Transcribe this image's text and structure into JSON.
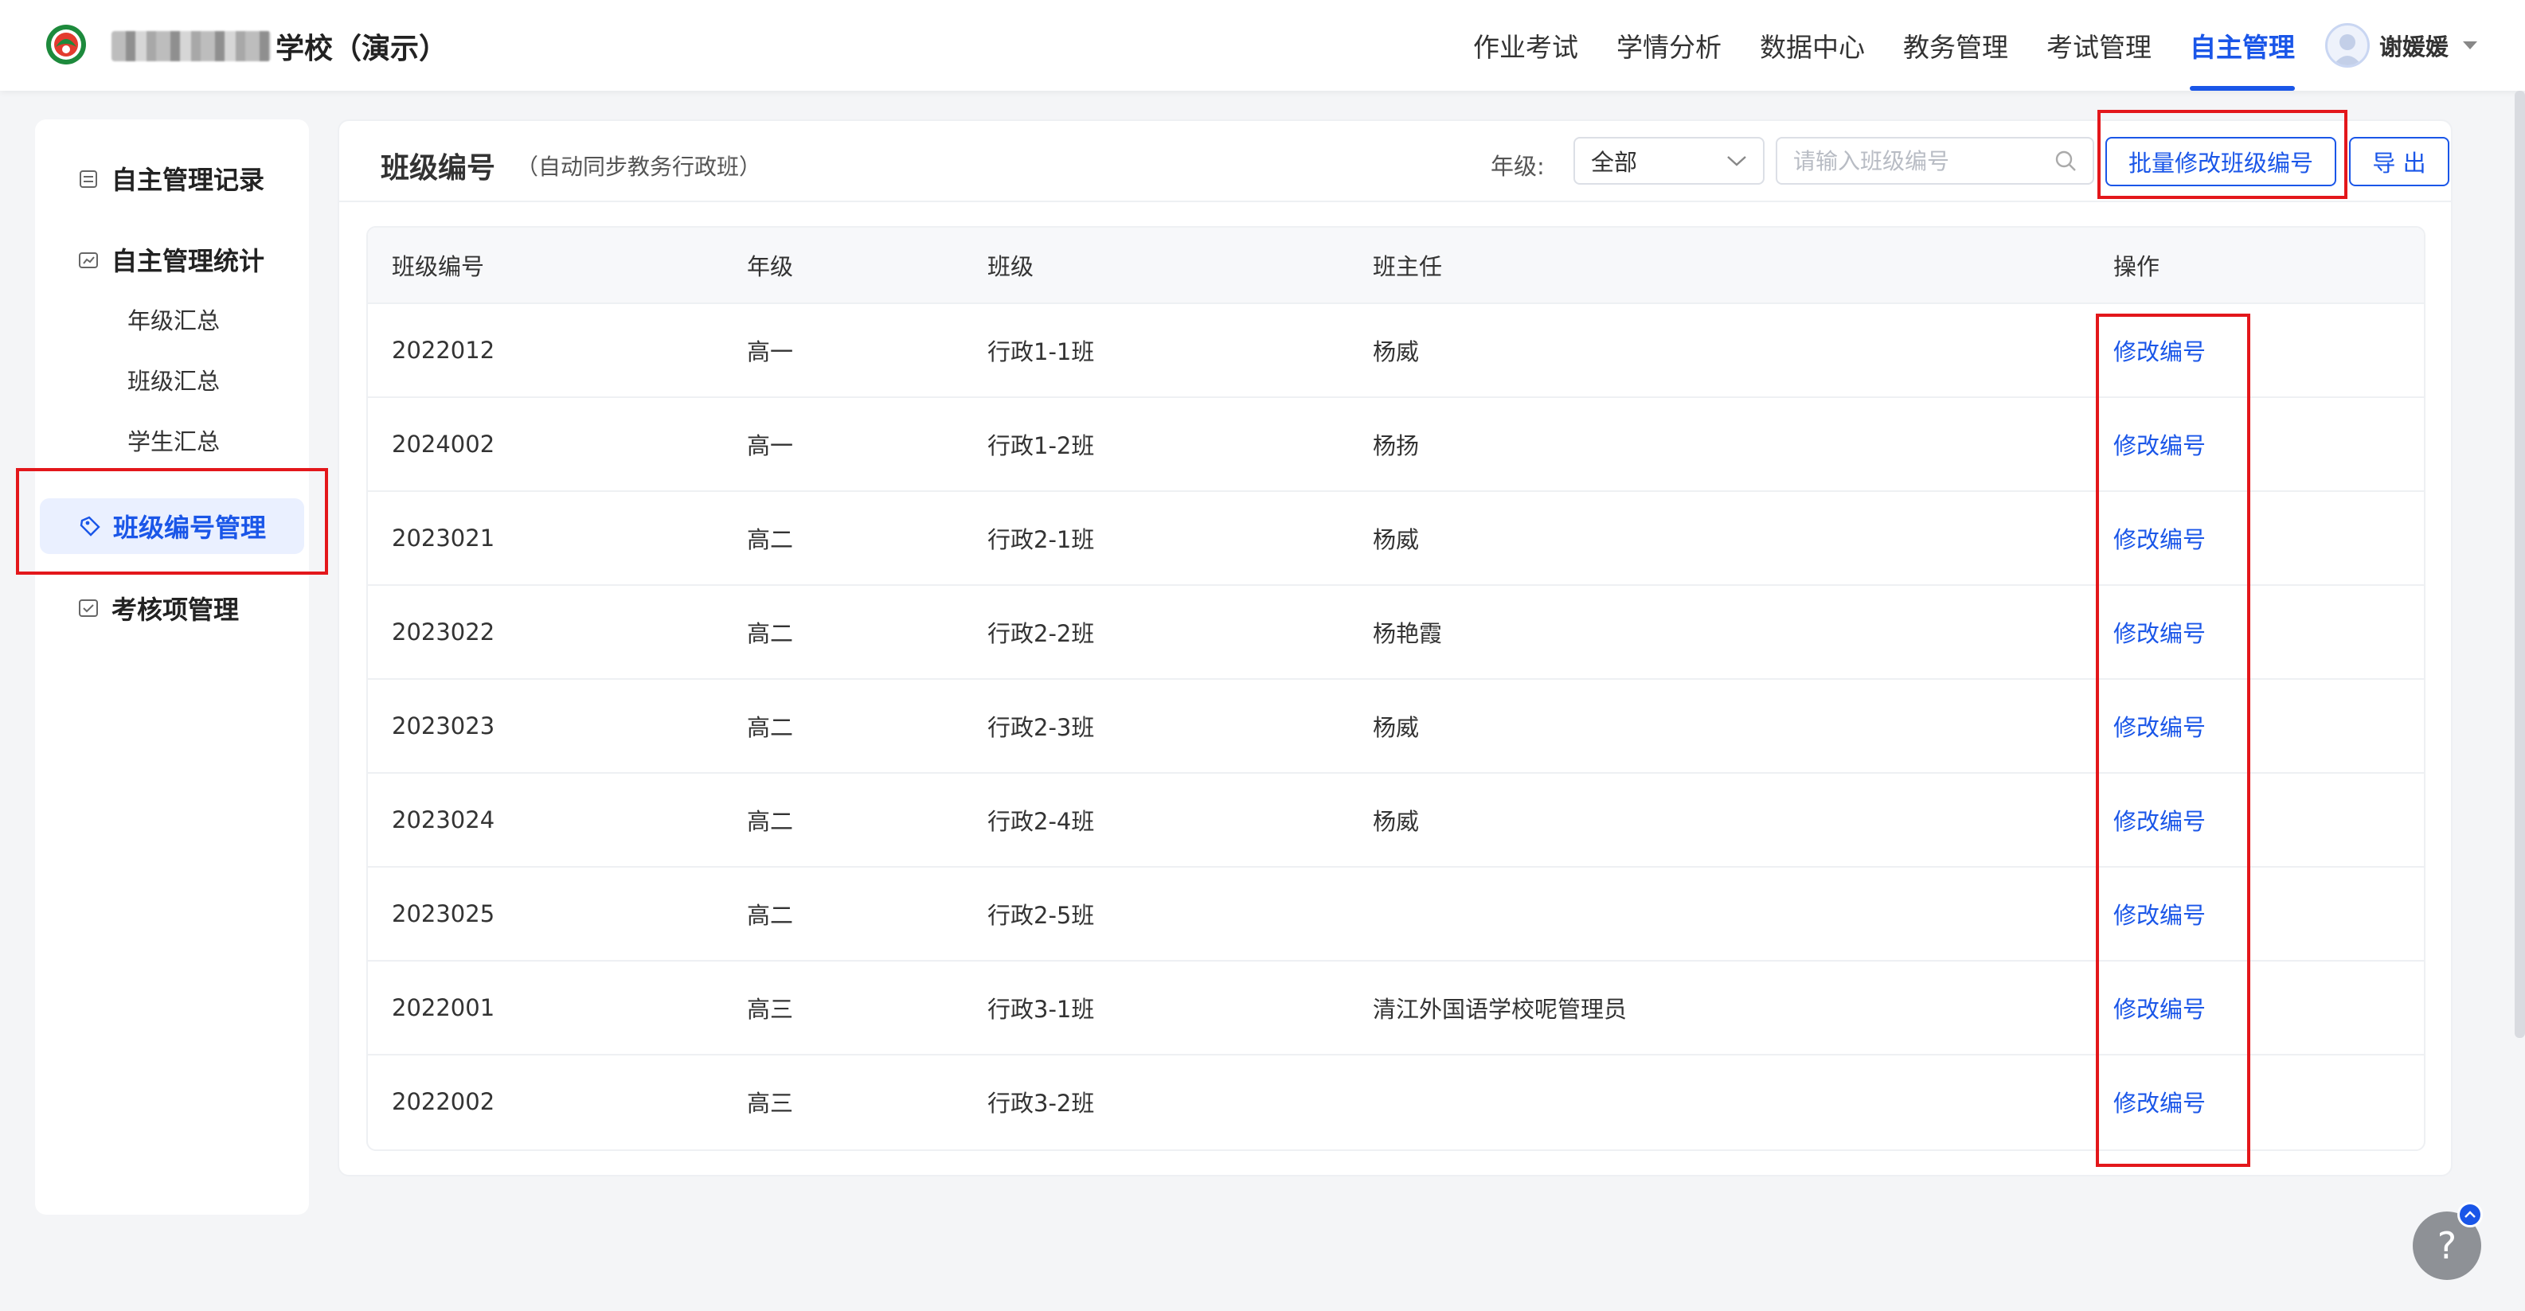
{
  "header": {
    "school_suffix": "学校（演示）",
    "nav": [
      "作业考试",
      "学情分析",
      "数据中心",
      "教务管理",
      "考试管理",
      "自主管理"
    ],
    "active_nav": "自主管理",
    "user_name": "谢媛媛"
  },
  "sidebar": {
    "record": "自主管理记录",
    "stats": "自主管理统计",
    "stats_items": [
      "年级汇总",
      "班级汇总",
      "学生汇总"
    ],
    "class_code": "班级编号管理",
    "assess": "考核项管理"
  },
  "main": {
    "title": "班级编号",
    "subtitle": "（自动同步教务行政班）",
    "grade_label": "年级:",
    "grade_value": "全部",
    "search_placeholder": "请输入班级编号",
    "batch_btn": "批量修改班级编号",
    "export_btn": "导 出"
  },
  "table": {
    "headers": [
      "班级编号",
      "年级",
      "班级",
      "班主任",
      "操作"
    ],
    "action_label": "修改编号",
    "rows": [
      {
        "code": "2022012",
        "grade": "高一",
        "class": "行政1-1班",
        "teacher": "杨威"
      },
      {
        "code": "2024002",
        "grade": "高一",
        "class": "行政1-2班",
        "teacher": "杨扬"
      },
      {
        "code": "2023021",
        "grade": "高二",
        "class": "行政2-1班",
        "teacher": "杨威"
      },
      {
        "code": "2023022",
        "grade": "高二",
        "class": "行政2-2班",
        "teacher": "杨艳霞"
      },
      {
        "code": "2023023",
        "grade": "高二",
        "class": "行政2-3班",
        "teacher": "杨威"
      },
      {
        "code": "2023024",
        "grade": "高二",
        "class": "行政2-4班",
        "teacher": "杨威"
      },
      {
        "code": "2023025",
        "grade": "高二",
        "class": "行政2-5班",
        "teacher": ""
      },
      {
        "code": "2022001",
        "grade": "高三",
        "class": "行政3-1班",
        "teacher": "清江外国语学校呢管理员"
      },
      {
        "code": "2022002",
        "grade": "高三",
        "class": "行政3-2班",
        "teacher": ""
      }
    ]
  },
  "help": "?",
  "colors": {
    "accent": "#1a56e8",
    "highlight": "#e3171b"
  }
}
